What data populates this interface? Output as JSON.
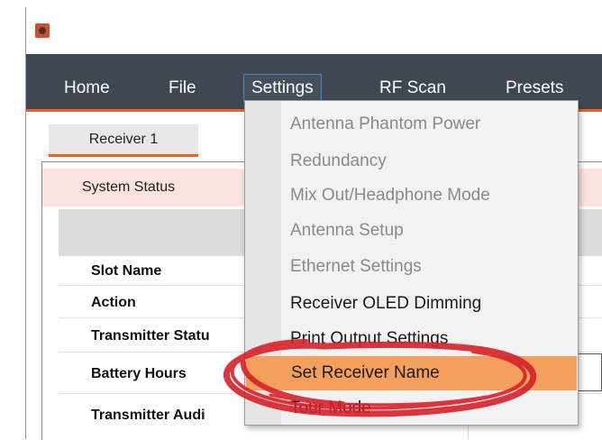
{
  "menubar": {
    "items": [
      "Home",
      "File",
      "Settings",
      "RF Scan",
      "Presets"
    ]
  },
  "tabs": {
    "receiver_tab": "Receiver 1"
  },
  "system_status": {
    "header": "System Status",
    "rows": [
      "Slot Name",
      "Action",
      "Transmitter Statu",
      "Battery Hours",
      "Transmitter Audi"
    ]
  },
  "settings_menu": {
    "items": [
      {
        "label": "Antenna Phantom Power",
        "state": "disabled"
      },
      {
        "label": "Redundancy",
        "state": "disabled"
      },
      {
        "label": "Mix Out/Headphone Mode",
        "state": "disabled"
      },
      {
        "label": "Antenna Setup",
        "state": "disabled"
      },
      {
        "label": "Ethernet Settings",
        "state": "disabled"
      },
      {
        "label": "Receiver OLED Dimming",
        "state": "enabled"
      },
      {
        "label": "Print Output Settings",
        "state": "enabled"
      },
      {
        "label": "Set Receiver Name",
        "state": "highlighted"
      },
      {
        "label": "Tour Mode",
        "state": "enabled"
      }
    ]
  },
  "colors": {
    "menubar_bg": "#3f4750",
    "accent_orange": "#e8602a",
    "highlight": "#f4a05c",
    "annotation_red": "#d8202a"
  }
}
